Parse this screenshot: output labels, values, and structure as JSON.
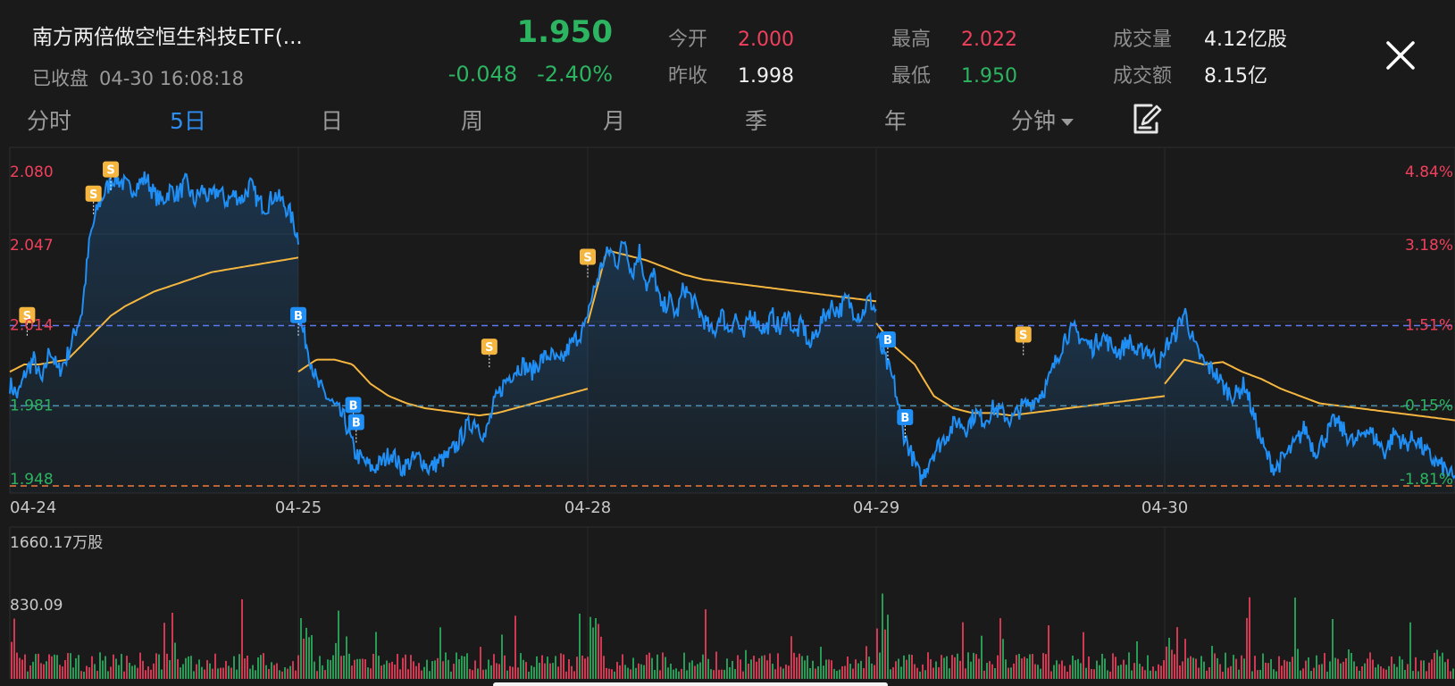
{
  "header": {
    "title": "南方两倍做空恒生科技ETF(...",
    "status": "已收盘",
    "datetime": "04-30 16:08:18",
    "price": "1.950",
    "change": "-0.048",
    "change_pct": "-2.40%"
  },
  "stats": {
    "open_label": "今开",
    "open": "2.000",
    "prev_close_label": "昨收",
    "prev_close": "1.998",
    "high_label": "最高",
    "high": "2.022",
    "low_label": "最低",
    "low": "1.950",
    "volume_label": "成交量",
    "volume": "4.12亿股",
    "turnover_label": "成交额",
    "turnover": "8.15亿"
  },
  "tabs": [
    "分时",
    "5日",
    "日",
    "周",
    "月",
    "季",
    "年",
    "分钟"
  ],
  "active_tab": "5日",
  "icons": {
    "close": "close-icon",
    "draw": "draw-edit-icon",
    "dropdown": "caret-down-icon"
  },
  "colors": {
    "up": "#f0405c",
    "down": "#2cb461",
    "price_line": "#1f8ef5",
    "avg_line": "#f5b640",
    "active_tab": "#2e8ef0",
    "marker_s": "#f5b640",
    "marker_b": "#1f8ef5"
  },
  "chart_data": {
    "type": "line",
    "y_labels_left": [
      "2.080",
      "2.047",
      "2.014",
      "1.981",
      "1.948"
    ],
    "y_labels_right": [
      "4.84%",
      "3.18%",
      "1.51%",
      "-0.15%",
      "-1.81%"
    ],
    "x_labels": [
      "04-24",
      "04-25",
      "04-28",
      "04-29",
      "04-30"
    ],
    "ylim": [
      1.948,
      2.08
    ],
    "reference_price": 1.998,
    "dashed_levels": [
      2.014,
      1.981,
      1.948
    ],
    "series": [
      {
        "name": "price",
        "days": [
          [
            1.99,
            1.985,
            1.995,
            2.0,
            1.99,
            2.005,
            1.995,
            2.0,
            2.01,
            2.02,
            2.05,
            2.063,
            2.07,
            2.075,
            2.073,
            2.07,
            2.072,
            2.075,
            2.068,
            2.065,
            2.07,
            2.068,
            2.073,
            2.065,
            2.07,
            2.066,
            2.07,
            2.065,
            2.068,
            2.066,
            2.072,
            2.065,
            2.063,
            2.068,
            2.065,
            2.06,
            2.05
          ],
          [
            2.018,
            2.005,
            1.99,
            1.985,
            1.98,
            1.975,
            1.962,
            1.958,
            1.955,
            1.958,
            1.962,
            1.955,
            1.958,
            1.96,
            1.955,
            1.958,
            1.96,
            1.965,
            1.972,
            1.975,
            1.968,
            1.982,
            1.99,
            1.995,
            1.998,
            1.995,
            2.0,
            2.002,
            1.998,
            2.005,
            2.01,
            2.015
          ],
          [
            2.02,
            2.03,
            2.04,
            2.045,
            2.04,
            2.05,
            2.035,
            2.045,
            2.03,
            2.035,
            2.02,
            2.025,
            2.018,
            2.03,
            2.025,
            2.02,
            2.015,
            2.01,
            2.02,
            2.012,
            2.018,
            2.008,
            2.02,
            2.015,
            2.012,
            2.018,
            2.012,
            2.02,
            2.01,
            2.015,
            2.005,
            2.012,
            2.018,
            2.022,
            2.02,
            2.025,
            2.02,
            2.018,
            2.025,
            2.02
          ],
          [
            2.01,
            2.0,
            1.99,
            1.97,
            1.96,
            1.95,
            1.96,
            1.965,
            1.97,
            1.975,
            1.972,
            1.978,
            1.975,
            1.98,
            1.978,
            1.975,
            1.98,
            1.982,
            1.985,
            1.99,
            2.0,
            2.01,
            2.012,
            2.008,
            2.005,
            2.01,
            2.006,
            2.003,
            2.008,
            2.002,
            2.005,
            2.0,
            2.0
          ],
          [
            2.005,
            2.01,
            2.02,
            2.005,
            1.998,
            1.995,
            1.988,
            1.985,
            1.99,
            1.975,
            1.962,
            1.955,
            1.96,
            1.965,
            1.972,
            1.962,
            1.968,
            1.975,
            1.97,
            1.965,
            1.972,
            1.968,
            1.962,
            1.97,
            1.965,
            1.968,
            1.962,
            1.958,
            1.955,
            1.95
          ]
        ]
      },
      {
        "name": "average",
        "days": [
          [
            1.995,
            1.998,
            1.998,
            1.999,
            2.0,
            2.006,
            2.012,
            2.018,
            2.022,
            2.025,
            2.028,
            2.03,
            2.032,
            2.034,
            2.036,
            2.037,
            2.038,
            2.039,
            2.04,
            2.041,
            2.042
          ],
          [
            1.995,
            2.0,
            2.0,
            1.998,
            1.99,
            1.985,
            1.982,
            1.98,
            1.979,
            1.978,
            1.977,
            1.978,
            1.98,
            1.982,
            1.984,
            1.986,
            1.988
          ],
          [
            2.015,
            2.045,
            2.043,
            2.041,
            2.038,
            2.035,
            2.033,
            2.032,
            2.031,
            2.03,
            2.029,
            2.028,
            2.027,
            2.026,
            2.025,
            2.024
          ],
          [
            2.015,
            2.005,
            1.998,
            1.985,
            1.98,
            1.978,
            1.978,
            1.977,
            1.978,
            1.979,
            1.98,
            1.981,
            1.982,
            1.983,
            1.984,
            1.985
          ],
          [
            1.99,
            2.0,
            1.998,
            1.999,
            1.995,
            1.992,
            1.988,
            1.985,
            1.982,
            1.981,
            1.98,
            1.979,
            1.978,
            1.977,
            1.976,
            1.975
          ]
        ]
      }
    ],
    "trade_markers": [
      {
        "type": "S",
        "day": 0,
        "pos": 0.06,
        "price": 2.015
      },
      {
        "type": "S",
        "day": 0,
        "pos": 0.29,
        "price": 2.065
      },
      {
        "type": "S",
        "day": 0,
        "pos": 0.35,
        "price": 2.075
      },
      {
        "type": "B",
        "day": 1,
        "pos": 0.0,
        "price": 2.015
      },
      {
        "type": "B",
        "day": 1,
        "pos": 0.19,
        "price": 1.978
      },
      {
        "type": "B",
        "day": 1,
        "pos": 0.2,
        "price": 1.971
      },
      {
        "type": "S",
        "day": 1,
        "pos": 0.66,
        "price": 2.002
      },
      {
        "type": "S",
        "day": 2,
        "pos": 0.0,
        "price": 2.039
      },
      {
        "type": "B",
        "day": 3,
        "pos": 0.04,
        "price": 2.005
      },
      {
        "type": "B",
        "day": 3,
        "pos": 0.1,
        "price": 1.973
      },
      {
        "type": "S",
        "day": 3,
        "pos": 0.51,
        "price": 2.007
      }
    ],
    "volume": {
      "type": "bar",
      "y_labels": [
        "1660.17万股",
        "830.09"
      ],
      "ylim": [
        0,
        1660.17
      ],
      "seed": 7
    }
  }
}
